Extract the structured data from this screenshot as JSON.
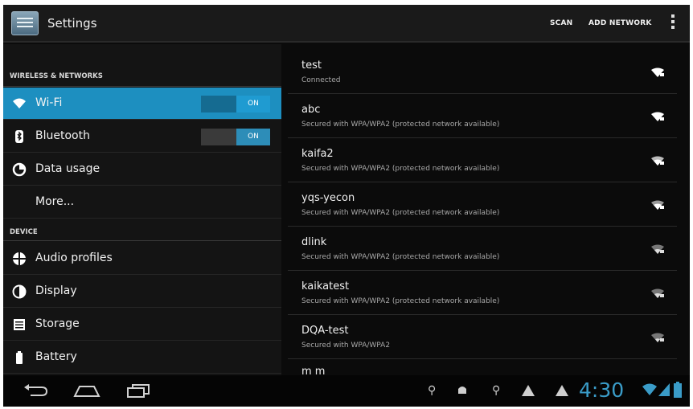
{
  "action_bar": {
    "title": "Settings",
    "scan_label": "SCAN",
    "add_network_label": "ADD NETWORK",
    "overflow_icon": "overflow-menu-icon"
  },
  "sidebar": {
    "sections": [
      {
        "header": "WIRELESS & NETWORKS",
        "items": [
          {
            "label": "Wi-Fi",
            "icon": "wifi-icon",
            "toggle": "ON",
            "selected": true
          },
          {
            "label": "Bluetooth",
            "icon": "bluetooth-icon",
            "toggle": "ON",
            "selected": false
          },
          {
            "label": "Data usage",
            "icon": "data-usage-icon"
          },
          {
            "label": "More..."
          }
        ]
      },
      {
        "header": "DEVICE",
        "items": [
          {
            "label": "Audio profiles",
            "icon": "audio-profiles-icon"
          },
          {
            "label": "Display",
            "icon": "display-icon"
          },
          {
            "label": "Storage",
            "icon": "storage-icon"
          },
          {
            "label": "Battery",
            "icon": "battery-icon"
          }
        ]
      }
    ]
  },
  "networks": [
    {
      "ssid": "test",
      "status": "Connected"
    },
    {
      "ssid": "abc",
      "status": "Secured with WPA/WPA2 (protected network available)"
    },
    {
      "ssid": "kaifa2",
      "status": "Secured with WPA/WPA2 (protected network available)"
    },
    {
      "ssid": "yqs-yecon",
      "status": "Secured with WPA/WPA2 (protected network available)"
    },
    {
      "ssid": "dlink",
      "status": "Secured with WPA/WPA2 (protected network available)"
    },
    {
      "ssid": "kaikatest",
      "status": "Secured with WPA/WPA2 (protected network available)"
    },
    {
      "ssid": "DQA-test",
      "status": "Secured with WPA/WPA2"
    },
    {
      "ssid": "m m",
      "status": ""
    }
  ],
  "status_bar": {
    "time": "4:30"
  },
  "colors": {
    "accent": "#1d8fc0",
    "clock": "#3a9cc8"
  }
}
